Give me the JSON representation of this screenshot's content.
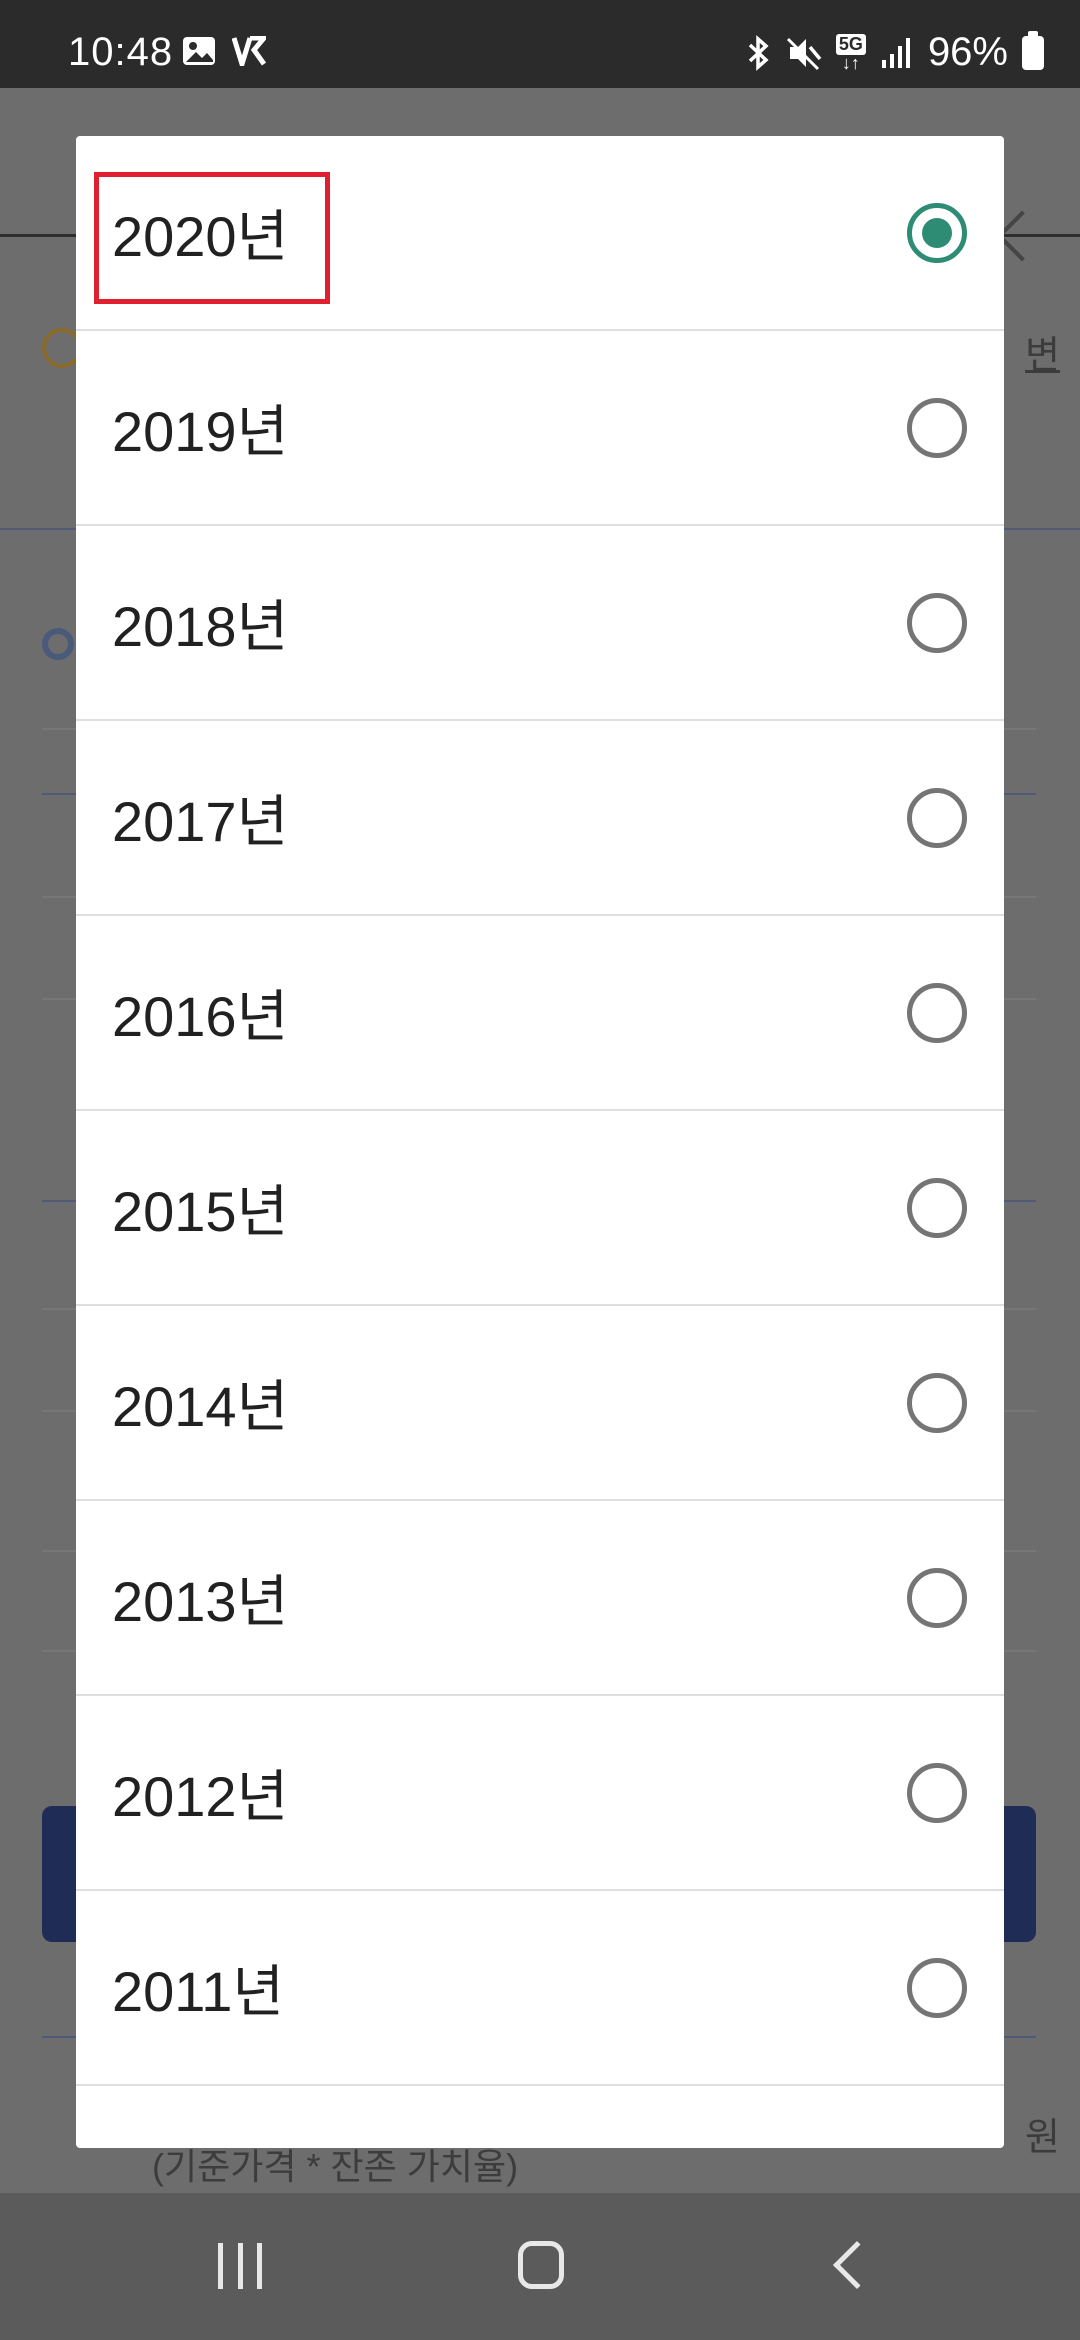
{
  "status_bar": {
    "time": "10:48",
    "signal": "5G",
    "battery": "96%"
  },
  "background": {
    "right_edge_char": "변",
    "bottom_text": "(기준가격 * 잔존 가치율)",
    "bottom_right_char": "원"
  },
  "dialog": {
    "options": [
      {
        "label": "2020년",
        "checked": true
      },
      {
        "label": "2019년",
        "checked": false
      },
      {
        "label": "2018년",
        "checked": false
      },
      {
        "label": "2017년",
        "checked": false
      },
      {
        "label": "2016년",
        "checked": false
      },
      {
        "label": "2015년",
        "checked": false
      },
      {
        "label": "2014년",
        "checked": false
      },
      {
        "label": "2013년",
        "checked": false
      },
      {
        "label": "2012년",
        "checked": false
      },
      {
        "label": "2011년",
        "checked": false
      }
    ]
  },
  "colors": {
    "radio_selected": "#2e8b74",
    "highlight": "#e0202e"
  }
}
